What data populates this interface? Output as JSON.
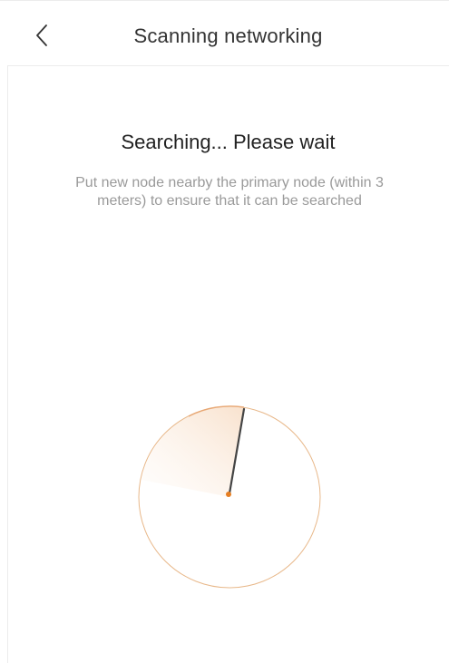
{
  "header": {
    "back_icon": "chevron-left-icon",
    "title": "Scanning networking"
  },
  "main": {
    "title": "Searching... Please wait",
    "hint": "Put new node nearby the primary node (within 3 meters) to ensure that it can be searched"
  },
  "radar": {
    "icon": "radar-sweep-icon",
    "colors": {
      "accent": "#e67e22",
      "ring": "#e8b88a",
      "needle": "#444444",
      "sweep": "#f6d8bd"
    }
  }
}
